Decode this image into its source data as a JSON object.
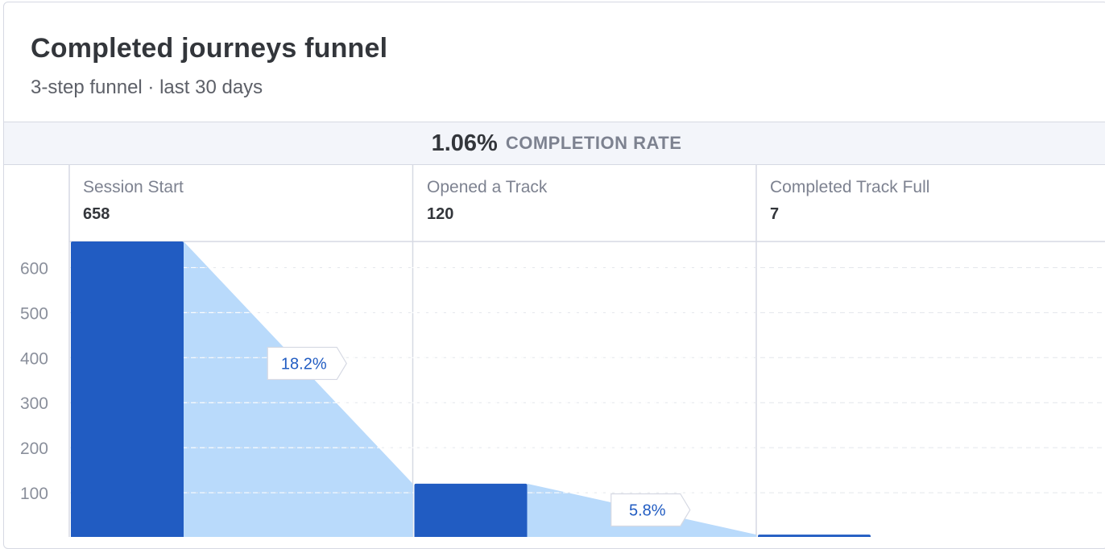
{
  "title": "Completed journeys funnel",
  "subtitle": "3-step funnel · last 30 days",
  "completion": {
    "value": "1.06%",
    "label": "COMPLETION RATE"
  },
  "colors": {
    "bar": "#215cc2",
    "flow": "#b9dafb",
    "grid_line": "#e3e6ec",
    "column_line": "#d6d9e3",
    "badge_text": "#215cc2",
    "axis_text": "#8a8f9b"
  },
  "chart_data": {
    "type": "bar",
    "title": "Completed journeys funnel",
    "categories": [
      "Session Start",
      "Opened a Track",
      "Completed Track Full"
    ],
    "counts": [
      "658",
      "120",
      "7"
    ],
    "values": [
      658,
      120,
      7
    ],
    "conversions": [
      "18.2%",
      "5.8%"
    ],
    "y_ticks": [
      "100",
      "200",
      "300",
      "400",
      "500",
      "600"
    ],
    "y_tick_values": [
      100,
      200,
      300,
      400,
      500,
      600
    ],
    "ylim": [
      0,
      658
    ],
    "grid": true,
    "legend": "none"
  }
}
